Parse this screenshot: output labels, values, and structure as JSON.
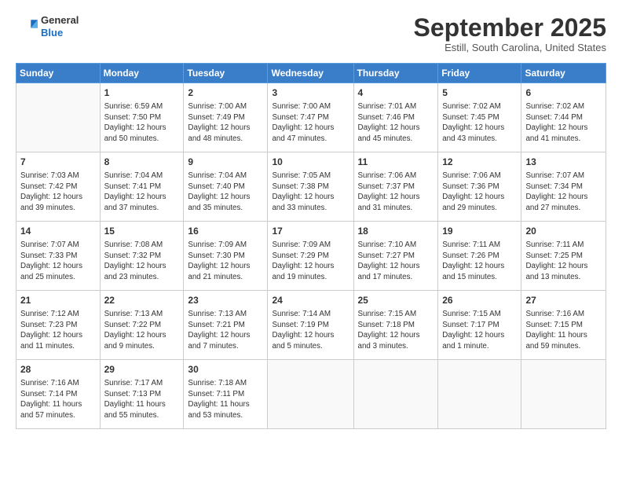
{
  "header": {
    "logo": {
      "general": "General",
      "blue": "Blue"
    },
    "title": "September 2025",
    "location": "Estill, South Carolina, United States"
  },
  "weekdays": [
    "Sunday",
    "Monday",
    "Tuesday",
    "Wednesday",
    "Thursday",
    "Friday",
    "Saturday"
  ],
  "weeks": [
    [
      {
        "day": "",
        "info": ""
      },
      {
        "day": "1",
        "info": "Sunrise: 6:59 AM\nSunset: 7:50 PM\nDaylight: 12 hours\nand 50 minutes."
      },
      {
        "day": "2",
        "info": "Sunrise: 7:00 AM\nSunset: 7:49 PM\nDaylight: 12 hours\nand 48 minutes."
      },
      {
        "day": "3",
        "info": "Sunrise: 7:00 AM\nSunset: 7:47 PM\nDaylight: 12 hours\nand 47 minutes."
      },
      {
        "day": "4",
        "info": "Sunrise: 7:01 AM\nSunset: 7:46 PM\nDaylight: 12 hours\nand 45 minutes."
      },
      {
        "day": "5",
        "info": "Sunrise: 7:02 AM\nSunset: 7:45 PM\nDaylight: 12 hours\nand 43 minutes."
      },
      {
        "day": "6",
        "info": "Sunrise: 7:02 AM\nSunset: 7:44 PM\nDaylight: 12 hours\nand 41 minutes."
      }
    ],
    [
      {
        "day": "7",
        "info": "Sunrise: 7:03 AM\nSunset: 7:42 PM\nDaylight: 12 hours\nand 39 minutes."
      },
      {
        "day": "8",
        "info": "Sunrise: 7:04 AM\nSunset: 7:41 PM\nDaylight: 12 hours\nand 37 minutes."
      },
      {
        "day": "9",
        "info": "Sunrise: 7:04 AM\nSunset: 7:40 PM\nDaylight: 12 hours\nand 35 minutes."
      },
      {
        "day": "10",
        "info": "Sunrise: 7:05 AM\nSunset: 7:38 PM\nDaylight: 12 hours\nand 33 minutes."
      },
      {
        "day": "11",
        "info": "Sunrise: 7:06 AM\nSunset: 7:37 PM\nDaylight: 12 hours\nand 31 minutes."
      },
      {
        "day": "12",
        "info": "Sunrise: 7:06 AM\nSunset: 7:36 PM\nDaylight: 12 hours\nand 29 minutes."
      },
      {
        "day": "13",
        "info": "Sunrise: 7:07 AM\nSunset: 7:34 PM\nDaylight: 12 hours\nand 27 minutes."
      }
    ],
    [
      {
        "day": "14",
        "info": "Sunrise: 7:07 AM\nSunset: 7:33 PM\nDaylight: 12 hours\nand 25 minutes."
      },
      {
        "day": "15",
        "info": "Sunrise: 7:08 AM\nSunset: 7:32 PM\nDaylight: 12 hours\nand 23 minutes."
      },
      {
        "day": "16",
        "info": "Sunrise: 7:09 AM\nSunset: 7:30 PM\nDaylight: 12 hours\nand 21 minutes."
      },
      {
        "day": "17",
        "info": "Sunrise: 7:09 AM\nSunset: 7:29 PM\nDaylight: 12 hours\nand 19 minutes."
      },
      {
        "day": "18",
        "info": "Sunrise: 7:10 AM\nSunset: 7:27 PM\nDaylight: 12 hours\nand 17 minutes."
      },
      {
        "day": "19",
        "info": "Sunrise: 7:11 AM\nSunset: 7:26 PM\nDaylight: 12 hours\nand 15 minutes."
      },
      {
        "day": "20",
        "info": "Sunrise: 7:11 AM\nSunset: 7:25 PM\nDaylight: 12 hours\nand 13 minutes."
      }
    ],
    [
      {
        "day": "21",
        "info": "Sunrise: 7:12 AM\nSunset: 7:23 PM\nDaylight: 12 hours\nand 11 minutes."
      },
      {
        "day": "22",
        "info": "Sunrise: 7:13 AM\nSunset: 7:22 PM\nDaylight: 12 hours\nand 9 minutes."
      },
      {
        "day": "23",
        "info": "Sunrise: 7:13 AM\nSunset: 7:21 PM\nDaylight: 12 hours\nand 7 minutes."
      },
      {
        "day": "24",
        "info": "Sunrise: 7:14 AM\nSunset: 7:19 PM\nDaylight: 12 hours\nand 5 minutes."
      },
      {
        "day": "25",
        "info": "Sunrise: 7:15 AM\nSunset: 7:18 PM\nDaylight: 12 hours\nand 3 minutes."
      },
      {
        "day": "26",
        "info": "Sunrise: 7:15 AM\nSunset: 7:17 PM\nDaylight: 12 hours\nand 1 minute."
      },
      {
        "day": "27",
        "info": "Sunrise: 7:16 AM\nSunset: 7:15 PM\nDaylight: 11 hours\nand 59 minutes."
      }
    ],
    [
      {
        "day": "28",
        "info": "Sunrise: 7:16 AM\nSunset: 7:14 PM\nDaylight: 11 hours\nand 57 minutes."
      },
      {
        "day": "29",
        "info": "Sunrise: 7:17 AM\nSunset: 7:13 PM\nDaylight: 11 hours\nand 55 minutes."
      },
      {
        "day": "30",
        "info": "Sunrise: 7:18 AM\nSunset: 7:11 PM\nDaylight: 11 hours\nand 53 minutes."
      },
      {
        "day": "",
        "info": ""
      },
      {
        "day": "",
        "info": ""
      },
      {
        "day": "",
        "info": ""
      },
      {
        "day": "",
        "info": ""
      }
    ]
  ]
}
